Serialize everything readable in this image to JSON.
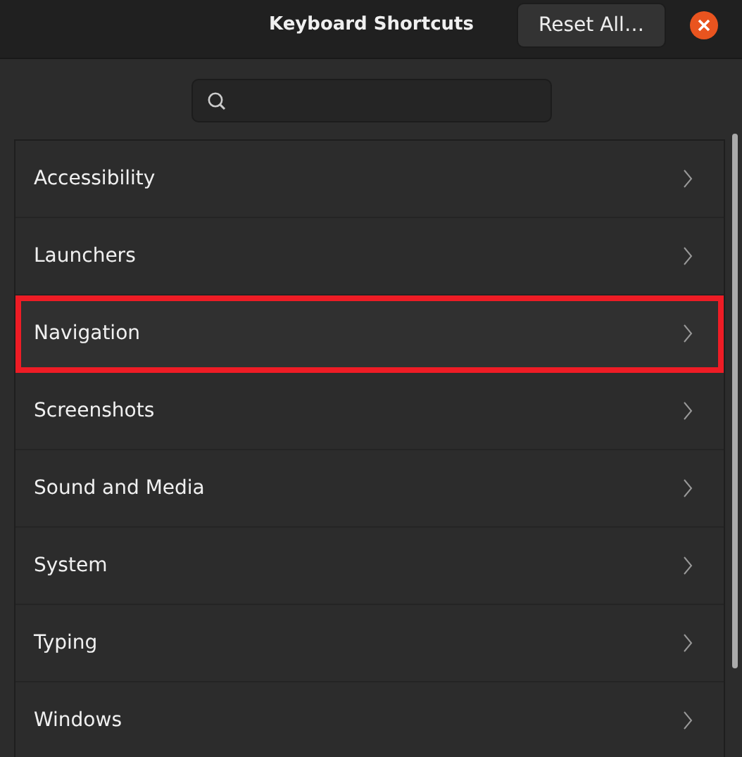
{
  "window": {
    "title": "Keyboard Shortcuts"
  },
  "header_button": {
    "label": "Reset All…"
  },
  "search": {
    "kind": "search"
  },
  "categories": [
    {
      "label": "Accessibility",
      "highlighted": false
    },
    {
      "label": "Launchers",
      "highlighted": false
    },
    {
      "label": "Navigation",
      "highlighted": true
    },
    {
      "label": "Screenshots",
      "highlighted": false
    },
    {
      "label": "Sound and Media",
      "highlighted": false
    },
    {
      "label": "System",
      "highlighted": false
    },
    {
      "label": "Typing",
      "highlighted": false
    },
    {
      "label": "Windows",
      "highlighted": false
    }
  ]
}
